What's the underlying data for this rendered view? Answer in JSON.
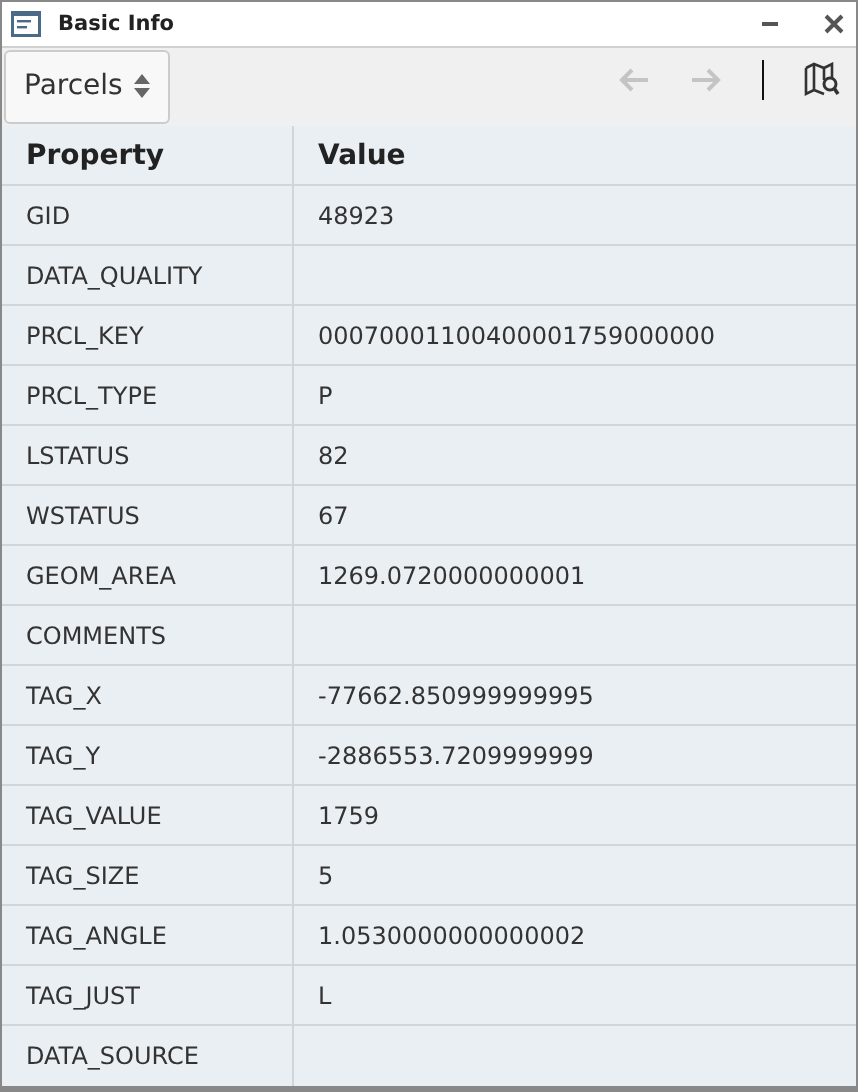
{
  "window": {
    "title": "Basic Info"
  },
  "toolbar": {
    "layer": "Parcels",
    "back": {
      "disabled": true
    },
    "forward": {
      "disabled": true
    }
  },
  "table": {
    "columns": [
      "Property",
      "Value"
    ],
    "rows": [
      {
        "property": "GID",
        "value": "48923"
      },
      {
        "property": "DATA_QUALITY",
        "value": ""
      },
      {
        "property": "PRCL_KEY",
        "value": "00070001100400001759000000"
      },
      {
        "property": "PRCL_TYPE",
        "value": "P"
      },
      {
        "property": "LSTATUS",
        "value": "82"
      },
      {
        "property": "WSTATUS",
        "value": "67"
      },
      {
        "property": "GEOM_AREA",
        "value": "1269.0720000000001"
      },
      {
        "property": "COMMENTS",
        "value": ""
      },
      {
        "property": "TAG_X",
        "value": "-77662.850999999995"
      },
      {
        "property": "TAG_Y",
        "value": "-2886553.7209999999"
      },
      {
        "property": "TAG_VALUE",
        "value": "1759"
      },
      {
        "property": "TAG_SIZE",
        "value": "5"
      },
      {
        "property": "TAG_ANGLE",
        "value": "1.0530000000000002"
      },
      {
        "property": "TAG_JUST",
        "value": "L"
      },
      {
        "property": "DATA_SOURCE",
        "value": ""
      }
    ]
  }
}
